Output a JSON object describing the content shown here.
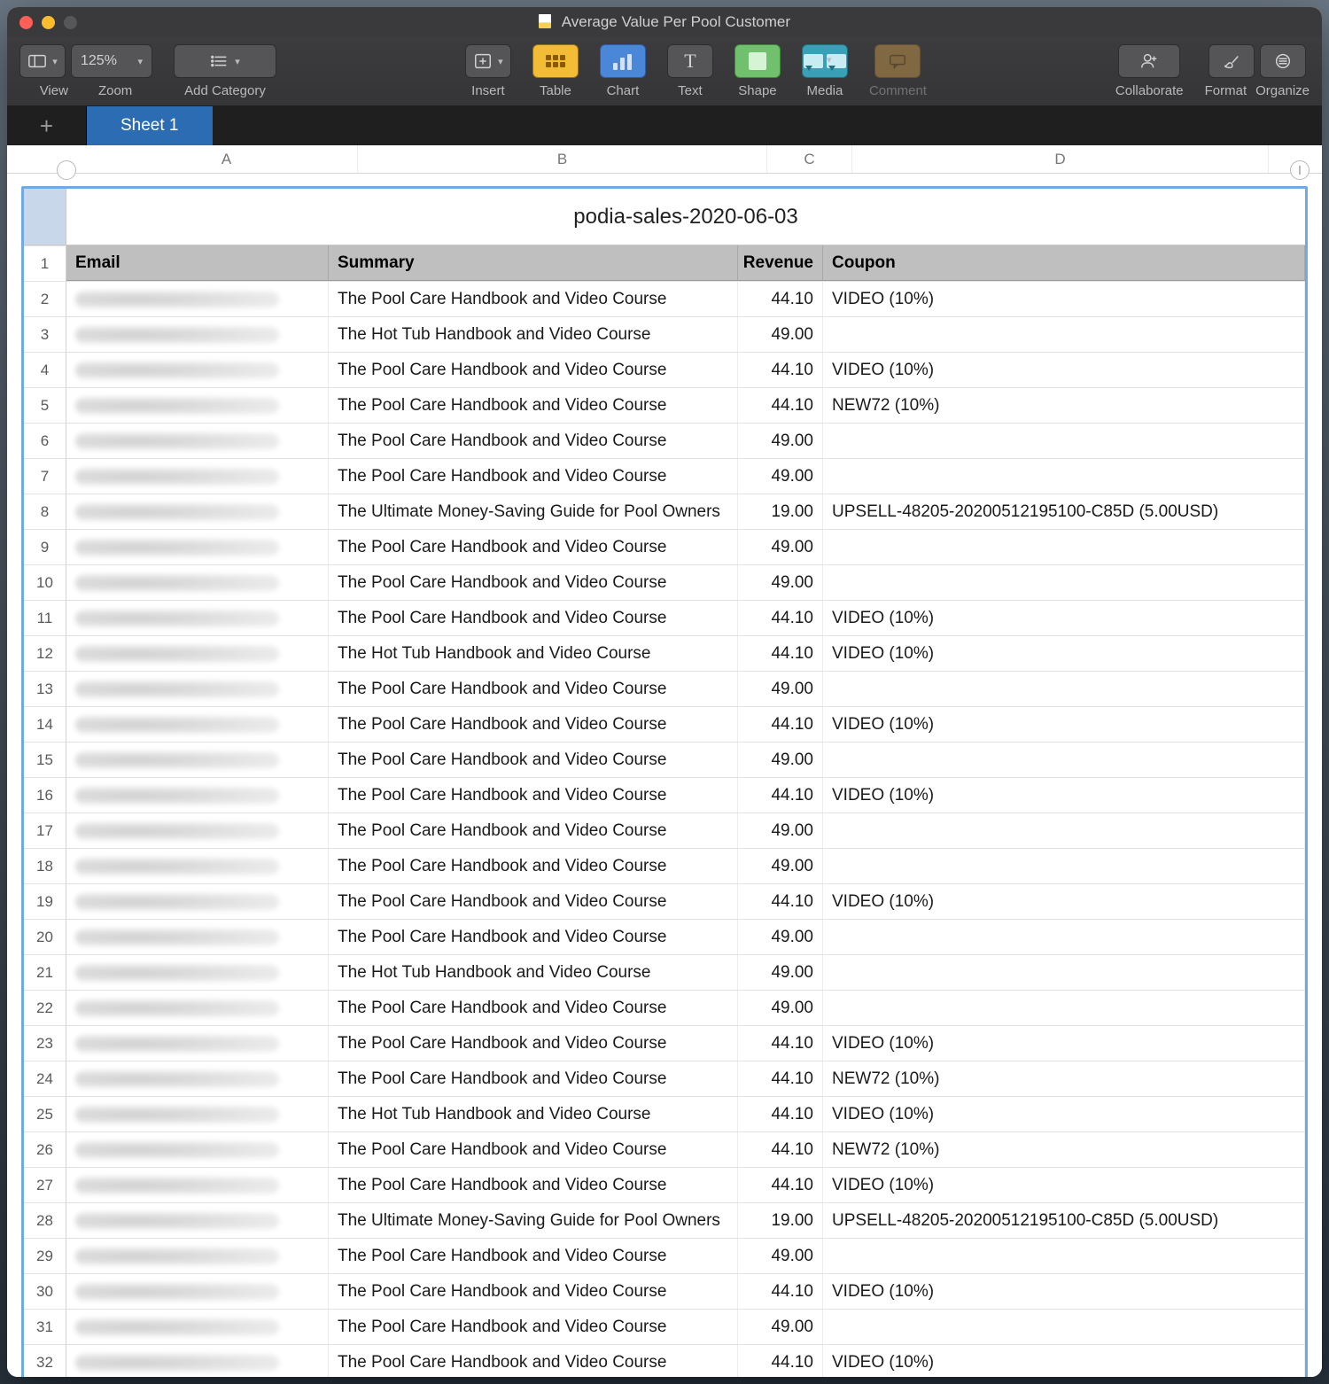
{
  "window": {
    "title": "Average Value Per Pool Customer"
  },
  "toolbar": {
    "view_label": "View",
    "zoom_value": "125%",
    "zoom_label": "Zoom",
    "add_category_label": "Add Category",
    "insert_label": "Insert",
    "table_label": "Table",
    "chart_label": "Chart",
    "text_label": "Text",
    "shape_label": "Shape",
    "media_label": "Media",
    "comment_label": "Comment",
    "collaborate_label": "Collaborate",
    "format_label": "Format",
    "organize_label": "Organize"
  },
  "tabs": {
    "sheet1": "Sheet 1"
  },
  "columns": {
    "A": "A",
    "B": "B",
    "C": "C",
    "D": "D"
  },
  "table_title": "podia-sales-2020-06-03",
  "headers": {
    "email": "Email",
    "summary": "Summary",
    "revenue": "Revenue",
    "coupon": "Coupon"
  },
  "rows": [
    {
      "n": "1"
    },
    {
      "n": "2",
      "summary": "The Pool Care Handbook and Video Course",
      "revenue": "44.10",
      "coupon": "VIDEO (10%)"
    },
    {
      "n": "3",
      "summary": "The Hot Tub Handbook and Video Course",
      "revenue": "49.00",
      "coupon": ""
    },
    {
      "n": "4",
      "summary": "The Pool Care Handbook and Video Course",
      "revenue": "44.10",
      "coupon": "VIDEO (10%)"
    },
    {
      "n": "5",
      "summary": "The Pool Care Handbook and Video Course",
      "revenue": "44.10",
      "coupon": "NEW72 (10%)"
    },
    {
      "n": "6",
      "summary": "The Pool Care Handbook and Video Course",
      "revenue": "49.00",
      "coupon": ""
    },
    {
      "n": "7",
      "summary": "The Pool Care Handbook and Video Course",
      "revenue": "49.00",
      "coupon": ""
    },
    {
      "n": "8",
      "summary": "The Ultimate Money-Saving Guide for Pool Owners",
      "revenue": "19.00",
      "coupon": "UPSELL-48205-20200512195100-C85D (5.00USD)"
    },
    {
      "n": "9",
      "summary": "The Pool Care Handbook and Video Course",
      "revenue": "49.00",
      "coupon": ""
    },
    {
      "n": "10",
      "summary": "The Pool Care Handbook and Video Course",
      "revenue": "49.00",
      "coupon": ""
    },
    {
      "n": "11",
      "summary": "The Pool Care Handbook and Video Course",
      "revenue": "44.10",
      "coupon": "VIDEO (10%)"
    },
    {
      "n": "12",
      "summary": "The Hot Tub Handbook and Video Course",
      "revenue": "44.10",
      "coupon": "VIDEO (10%)"
    },
    {
      "n": "13",
      "summary": "The Pool Care Handbook and Video Course",
      "revenue": "49.00",
      "coupon": ""
    },
    {
      "n": "14",
      "summary": "The Pool Care Handbook and Video Course",
      "revenue": "44.10",
      "coupon": "VIDEO (10%)"
    },
    {
      "n": "15",
      "summary": "The Pool Care Handbook and Video Course",
      "revenue": "49.00",
      "coupon": ""
    },
    {
      "n": "16",
      "summary": "The Pool Care Handbook and Video Course",
      "revenue": "44.10",
      "coupon": "VIDEO (10%)"
    },
    {
      "n": "17",
      "summary": "The Pool Care Handbook and Video Course",
      "revenue": "49.00",
      "coupon": ""
    },
    {
      "n": "18",
      "summary": "The Pool Care Handbook and Video Course",
      "revenue": "49.00",
      "coupon": ""
    },
    {
      "n": "19",
      "summary": "The Pool Care Handbook and Video Course",
      "revenue": "44.10",
      "coupon": "VIDEO (10%)"
    },
    {
      "n": "20",
      "summary": "The Pool Care Handbook and Video Course",
      "revenue": "49.00",
      "coupon": ""
    },
    {
      "n": "21",
      "summary": "The Hot Tub Handbook and Video Course",
      "revenue": "49.00",
      "coupon": ""
    },
    {
      "n": "22",
      "summary": "The Pool Care Handbook and Video Course",
      "revenue": "49.00",
      "coupon": ""
    },
    {
      "n": "23",
      "summary": "The Pool Care Handbook and Video Course",
      "revenue": "44.10",
      "coupon": "VIDEO (10%)"
    },
    {
      "n": "24",
      "summary": "The Pool Care Handbook and Video Course",
      "revenue": "44.10",
      "coupon": "NEW72 (10%)"
    },
    {
      "n": "25",
      "summary": "The Hot Tub Handbook and Video Course",
      "revenue": "44.10",
      "coupon": "VIDEO (10%)"
    },
    {
      "n": "26",
      "summary": "The Pool Care Handbook and Video Course",
      "revenue": "44.10",
      "coupon": "NEW72 (10%)"
    },
    {
      "n": "27",
      "summary": "The Pool Care Handbook and Video Course",
      "revenue": "44.10",
      "coupon": "VIDEO (10%)"
    },
    {
      "n": "28",
      "summary": "The Ultimate Money-Saving Guide for Pool Owners",
      "revenue": "19.00",
      "coupon": "UPSELL-48205-20200512195100-C85D (5.00USD)"
    },
    {
      "n": "29",
      "summary": "The Pool Care Handbook and Video Course",
      "revenue": "49.00",
      "coupon": ""
    },
    {
      "n": "30",
      "summary": "The Pool Care Handbook and Video Course",
      "revenue": "44.10",
      "coupon": "VIDEO (10%)"
    },
    {
      "n": "31",
      "summary": "The Pool Care Handbook and Video Course",
      "revenue": "49.00",
      "coupon": ""
    },
    {
      "n": "32",
      "summary": "The Pool Care Handbook and Video Course",
      "revenue": "44.10",
      "coupon": "VIDEO (10%)"
    }
  ]
}
